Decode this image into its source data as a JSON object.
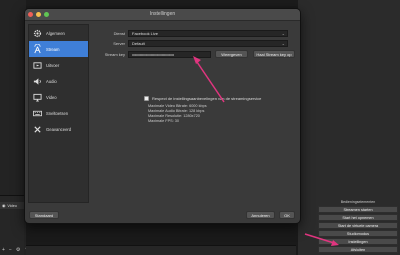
{
  "dialog": {
    "title": "Instellingen",
    "sidebar": [
      {
        "label": "Algemeen",
        "icon": "gear-icon"
      },
      {
        "label": "Stream",
        "icon": "antenna-icon"
      },
      {
        "label": "Uitvoer",
        "icon": "output-icon"
      },
      {
        "label": "Audio",
        "icon": "speaker-icon"
      },
      {
        "label": "Video",
        "icon": "monitor-icon"
      },
      {
        "label": "Sneltoetsen",
        "icon": "keyboard-icon"
      },
      {
        "label": "Geavanceerd",
        "icon": "tools-icon"
      }
    ],
    "service_label": "Dienst",
    "service_value": "Facebook Live",
    "server_label": "Server",
    "server_value": "Default",
    "key_label": "Stream key",
    "key_value": "••••••••••••••••••••••••••••••••••••••",
    "show_button": "Weergeven",
    "get_key_button": "Haal Stream key op",
    "checkbox_label": "Respect de instellingsaanbevelingen van de streamingservice",
    "info_lines": [
      "Maximale Video Bitrate: 6000 kbps",
      "Maximale Audio Bitrate: 128 kbps",
      "Maximale Resolutie: 1280x720",
      "Maximale FPS: 30"
    ],
    "defaults_button": "Standaard",
    "cancel_button": "Annuleren",
    "ok_button": "OK"
  },
  "controls": {
    "header": "Bedieningselementen",
    "buttons": [
      "Streamen starten",
      "Start het opnemen",
      "Start de virtuele camera",
      "Studiomodus",
      "Instellingen",
      "Afsluiten"
    ]
  },
  "scenes": {
    "header": "",
    "item": "Video"
  },
  "accent_color": "#e0357f",
  "selection_color": "#3f7fd8"
}
